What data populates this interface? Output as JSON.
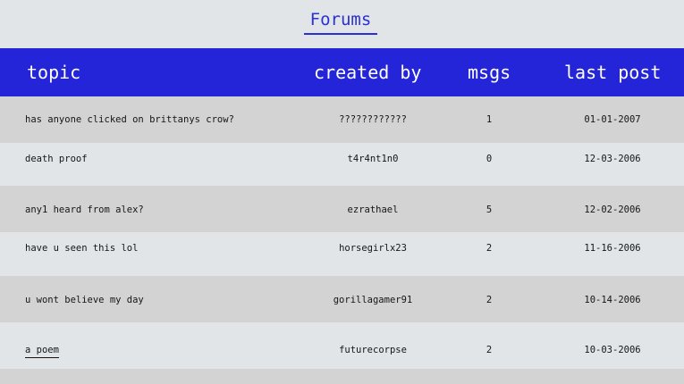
{
  "header": {
    "title": "Forums"
  },
  "columns": {
    "topic": "topic",
    "created_by": "created by",
    "msgs": "msgs",
    "last_post": "last post"
  },
  "rows": [
    {
      "topic": "has anyone clicked on brittanys crow?",
      "created_by": "????????????",
      "msgs": "1",
      "last_post": "01-01-2007"
    },
    {
      "topic": "death proof",
      "created_by": "t4r4nt1n0",
      "msgs": "0",
      "last_post": "12-03-2006"
    },
    {
      "topic": "any1 heard from alex?",
      "created_by": "ezrathael",
      "msgs": "5",
      "last_post": "12-02-2006"
    },
    {
      "topic": "have u seen this lol",
      "created_by": "horsegirlx23",
      "msgs": "2",
      "last_post": "11-16-2006"
    },
    {
      "topic": "u wont believe my day",
      "created_by": "gorillagamer91",
      "msgs": "2",
      "last_post": "10-14-2006"
    },
    {
      "topic": "a poem",
      "created_by": "futurecorpse",
      "msgs": "2",
      "last_post": "10-03-2006"
    }
  ]
}
